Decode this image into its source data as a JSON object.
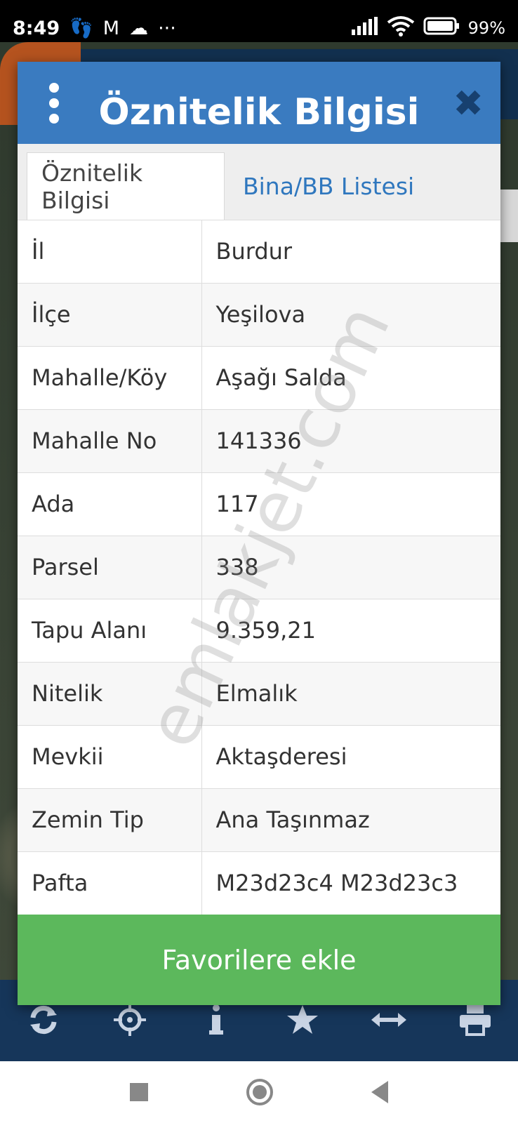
{
  "status_bar": {
    "time": "8:49",
    "notif_icons": [
      "👣",
      "M",
      "☁",
      "···"
    ],
    "battery": "99%"
  },
  "dialog": {
    "title": "Öznitelik Bilgisi",
    "tabs": [
      {
        "label": "Öznitelik Bilgisi",
        "active": true
      },
      {
        "label": "Bina/BB Listesi",
        "active": false
      }
    ],
    "rows": [
      {
        "key": "İl",
        "value": "Burdur"
      },
      {
        "key": "İlçe",
        "value": "Yeşilova"
      },
      {
        "key": "Mahalle/Köy",
        "value": "Aşağı Salda"
      },
      {
        "key": "Mahalle No",
        "value": "141336"
      },
      {
        "key": "Ada",
        "value": "117"
      },
      {
        "key": "Parsel",
        "value": "338"
      },
      {
        "key": "Tapu Alanı",
        "value": "9.359,21"
      },
      {
        "key": "Nitelik",
        "value": "Elmalık"
      },
      {
        "key": "Mevkii",
        "value": "Aktaşderesi"
      },
      {
        "key": "Zemin Tip",
        "value": "Ana Taşınmaz"
      },
      {
        "key": "Pafta",
        "value": "M23d23c4 M23d23c3"
      }
    ],
    "favorite_button": "Favorilere ekle",
    "watermark": "emlakjet.com"
  },
  "toolbar_icons": [
    "refresh-icon",
    "locate-icon",
    "info-icon",
    "star-icon",
    "measure-icon",
    "print-icon"
  ],
  "colors": {
    "header": "#3a7bc0",
    "tab_link": "#2f77be",
    "button": "#5cb85c",
    "toolbar": "#16365a"
  }
}
